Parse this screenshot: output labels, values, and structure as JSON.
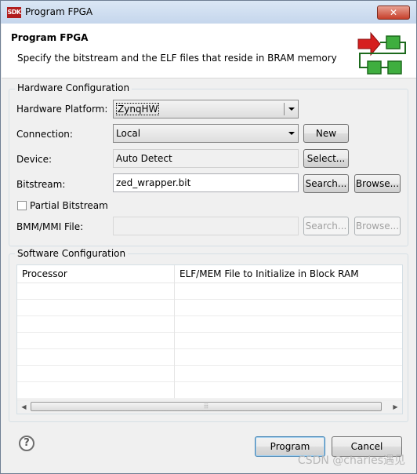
{
  "window": {
    "icon_text": "SDK",
    "title": "Program FPGA",
    "close_label": "✕"
  },
  "header": {
    "title": "Program FPGA",
    "description": "Specify the bitstream and the ELF files that reside in BRAM memory"
  },
  "hardware": {
    "group_label": "Hardware Configuration",
    "platform_label": "Hardware Platform:",
    "platform_value": "ZynqHW",
    "connection_label": "Connection:",
    "connection_value": "Local",
    "new_button": "New",
    "device_label": "Device:",
    "device_value": "Auto Detect",
    "select_button": "Select...",
    "bitstream_label": "Bitstream:",
    "bitstream_value": "zed_wrapper.bit",
    "bitstream_search": "Search...",
    "bitstream_browse": "Browse...",
    "partial_label": "Partial Bitstream",
    "partial_checked": false,
    "bmm_label": "BMM/MMI File:",
    "bmm_value": "",
    "bmm_search": "Search...",
    "bmm_browse": "Browse..."
  },
  "software": {
    "group_label": "Software Configuration",
    "columns": [
      "Processor",
      "ELF/MEM File to Initialize in Block RAM"
    ],
    "rows": []
  },
  "footer": {
    "help_icon": "?",
    "program_button": "Program",
    "cancel_button": "Cancel",
    "watermark": "CSDN @charles遇见"
  },
  "colors": {
    "title_bar": "#c5d6ec",
    "close_button": "#c7402b",
    "default_button_border": "#3c7fb1"
  }
}
